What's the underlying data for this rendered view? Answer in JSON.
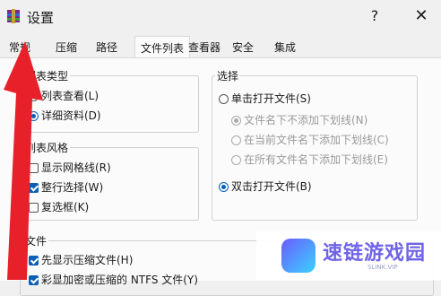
{
  "window": {
    "title": "设置",
    "help": "?",
    "close": "✕"
  },
  "tabs": [
    {
      "label": "常规",
      "active": false
    },
    {
      "label": "压缩",
      "active": false
    },
    {
      "label": "路径",
      "active": false
    },
    {
      "label": "文件列表",
      "active": true
    },
    {
      "label": "查看器",
      "active": false
    },
    {
      "label": "安全",
      "active": false
    },
    {
      "label": "集成",
      "active": false
    }
  ],
  "list_type": {
    "title": "列表类型",
    "options": [
      {
        "label": "列表查看(L)",
        "selected": false
      },
      {
        "label": "详细资料(D)",
        "selected": true
      }
    ]
  },
  "list_style": {
    "title": "列表风格",
    "options": [
      {
        "label": "显示网格线(R)",
        "checked": false
      },
      {
        "label": "整行选择(W)",
        "checked": true
      },
      {
        "label": "复选框(K)",
        "checked": false
      }
    ]
  },
  "selection": {
    "title": "选择",
    "single": {
      "label": "单击打开文件(S)",
      "selected": false
    },
    "sub_options": [
      {
        "label": "文件名下不添加下划线(N)",
        "selected": true
      },
      {
        "label": "在当前文件名下添加下划线(C)",
        "selected": false
      },
      {
        "label": "在所有文件名下添加下划线(E)",
        "selected": false
      }
    ],
    "double": {
      "label": "双击打开文件(B)",
      "selected": true
    }
  },
  "files": {
    "title": "文件",
    "options": [
      {
        "label": "先显示压缩文件(H)",
        "checked": true
      },
      {
        "label": "彩显加密或压缩的 NTFS 文件(Y)",
        "checked": true
      }
    ]
  },
  "watermark": {
    "text": "速链游戏园",
    "sub": "SLINK.VIP"
  },
  "colors": {
    "accent": "#0a5fb4",
    "arrow": "#e8202a"
  }
}
